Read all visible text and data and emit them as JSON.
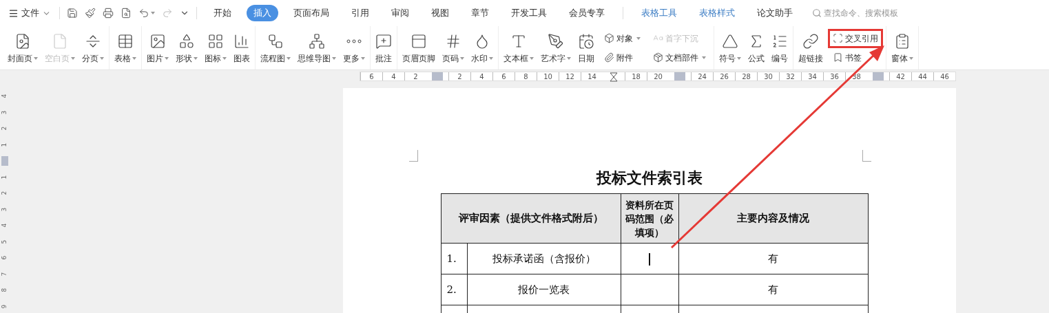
{
  "menu_bar": {
    "file_menu": "文件",
    "tabs": [
      {
        "label": "开始",
        "selected": false,
        "contextual": false
      },
      {
        "label": "插入",
        "selected": true,
        "contextual": false
      },
      {
        "label": "页面布局",
        "selected": false,
        "contextual": false
      },
      {
        "label": "引用",
        "selected": false,
        "contextual": false
      },
      {
        "label": "审阅",
        "selected": false,
        "contextual": false
      },
      {
        "label": "视图",
        "selected": false,
        "contextual": false
      },
      {
        "label": "章节",
        "selected": false,
        "contextual": false
      },
      {
        "label": "开发工具",
        "selected": false,
        "contextual": false
      },
      {
        "label": "会员专享",
        "selected": false,
        "contextual": false
      },
      {
        "label": "表格工具",
        "selected": false,
        "contextual": true
      },
      {
        "label": "表格样式",
        "selected": false,
        "contextual": true
      },
      {
        "label": "论文助手",
        "selected": false,
        "contextual": false
      }
    ],
    "search": {
      "placeholder": "查找命令、搜索模板"
    }
  },
  "ribbon": {
    "groups": [
      {
        "items": [
          {
            "kind": "large",
            "label": "封面页",
            "dropdown": true,
            "disabled": false
          },
          {
            "kind": "large",
            "label": "空白页",
            "dropdown": true,
            "disabled": true
          },
          {
            "kind": "large",
            "label": "分页",
            "dropdown": true,
            "disabled": false
          }
        ]
      },
      {
        "items": [
          {
            "kind": "large",
            "label": "表格",
            "dropdown": true,
            "disabled": false
          }
        ]
      },
      {
        "items": [
          {
            "kind": "large",
            "label": "图片",
            "dropdown": true,
            "disabled": false
          },
          {
            "kind": "large",
            "label": "形状",
            "dropdown": true,
            "disabled": false
          },
          {
            "kind": "large",
            "label": "图标",
            "dropdown": true,
            "disabled": false
          },
          {
            "kind": "large",
            "label": "图表",
            "dropdown": false,
            "disabled": false
          }
        ]
      },
      {
        "items": [
          {
            "kind": "large",
            "label": "流程图",
            "dropdown": true,
            "disabled": false
          },
          {
            "kind": "large",
            "label": "思维导图",
            "dropdown": true,
            "disabled": false
          },
          {
            "kind": "large",
            "label": "更多",
            "dropdown": true,
            "disabled": false
          }
        ]
      },
      {
        "items": [
          {
            "kind": "large",
            "label": "批注",
            "dropdown": false,
            "disabled": false
          }
        ]
      },
      {
        "items": [
          {
            "kind": "large",
            "label": "页眉页脚",
            "dropdown": false,
            "disabled": false
          },
          {
            "kind": "large",
            "label": "页码",
            "dropdown": true,
            "disabled": false
          },
          {
            "kind": "large",
            "label": "水印",
            "dropdown": true,
            "disabled": false
          }
        ]
      },
      {
        "items": [
          {
            "kind": "large",
            "label": "文本框",
            "dropdown": true,
            "disabled": false
          },
          {
            "kind": "large",
            "label": "艺术字",
            "dropdown": true,
            "disabled": false
          },
          {
            "kind": "large",
            "label": "日期",
            "dropdown": false,
            "disabled": false
          },
          {
            "kind": "stack",
            "rows": [
              {
                "label": "对象",
                "dropdown": true,
                "disabled": false,
                "highlighted": false
              },
              {
                "label": "附件",
                "dropdown": false,
                "disabled": false,
                "highlighted": false
              }
            ]
          },
          {
            "kind": "stack",
            "rows": [
              {
                "label": "首字下沉",
                "dropdown": false,
                "disabled": true,
                "highlighted": false
              },
              {
                "label": "文档部件",
                "dropdown": true,
                "disabled": false,
                "highlighted": false
              }
            ]
          }
        ]
      },
      {
        "items": [
          {
            "kind": "large",
            "label": "符号",
            "dropdown": true,
            "disabled": false
          },
          {
            "kind": "large",
            "label": "公式",
            "dropdown": false,
            "disabled": false
          },
          {
            "kind": "large",
            "label": "编号",
            "dropdown": false,
            "disabled": false
          }
        ]
      },
      {
        "items": [
          {
            "kind": "large",
            "label": "超链接",
            "dropdown": false,
            "disabled": false
          },
          {
            "kind": "stack",
            "rows": [
              {
                "label": "交叉引用",
                "dropdown": false,
                "disabled": false,
                "highlighted": true
              },
              {
                "label": "书签",
                "dropdown": false,
                "disabled": false,
                "highlighted": false
              }
            ]
          }
        ]
      },
      {
        "items": [
          {
            "kind": "large",
            "label": "窗体",
            "dropdown": true,
            "disabled": false
          }
        ]
      }
    ]
  },
  "ruler": {
    "slots": [
      {
        "kind": "num",
        "label": "6"
      },
      {
        "kind": "num",
        "label": "4"
      },
      {
        "kind": "num",
        "label": "2"
      },
      {
        "kind": "margin"
      },
      {
        "kind": "num",
        "label": "2"
      },
      {
        "kind": "num",
        "label": "4"
      },
      {
        "kind": "num",
        "label": "6"
      },
      {
        "kind": "num",
        "label": "8"
      },
      {
        "kind": "num",
        "label": "10"
      },
      {
        "kind": "num",
        "label": "12"
      },
      {
        "kind": "num",
        "label": "14"
      },
      {
        "kind": "indent"
      },
      {
        "kind": "num",
        "label": "18"
      },
      {
        "kind": "num",
        "label": "20"
      },
      {
        "kind": "margin"
      },
      {
        "kind": "num",
        "label": "24"
      },
      {
        "kind": "num",
        "label": "26"
      },
      {
        "kind": "num",
        "label": "28"
      },
      {
        "kind": "num",
        "label": "30"
      },
      {
        "kind": "num",
        "label": "32"
      },
      {
        "kind": "num",
        "label": "34"
      },
      {
        "kind": "num",
        "label": "36"
      },
      {
        "kind": "num",
        "label": "38"
      },
      {
        "kind": "margin"
      },
      {
        "kind": "num",
        "label": "42"
      },
      {
        "kind": "num",
        "label": "44"
      },
      {
        "kind": "num",
        "label": "46"
      }
    ]
  },
  "vertical_ruler": {
    "slots": [
      {
        "kind": "num",
        "label": "4"
      },
      {
        "kind": "num",
        "label": "3"
      },
      {
        "kind": "num",
        "label": "2"
      },
      {
        "kind": "num",
        "label": "1"
      },
      {
        "kind": "margin"
      },
      {
        "kind": "num",
        "label": "1"
      },
      {
        "kind": "num",
        "label": "2"
      },
      {
        "kind": "num",
        "label": "3"
      },
      {
        "kind": "num",
        "label": "4"
      },
      {
        "kind": "num",
        "label": "5"
      },
      {
        "kind": "num",
        "label": "6"
      },
      {
        "kind": "num",
        "label": "7"
      },
      {
        "kind": "num",
        "label": "8"
      },
      {
        "kind": "num",
        "label": "9"
      }
    ]
  },
  "document": {
    "title": "投标文件索引表",
    "table": {
      "columns": [
        "评审因素（提供文件格式附后）",
        "资料所在页码范围（必填项）",
        "主要内容及情况"
      ],
      "rows": [
        {
          "number": "1.",
          "item": "投标承诺函（含报价）",
          "pages": "",
          "caret": true,
          "content": "有"
        },
        {
          "number": "2.",
          "item": "报价一览表",
          "pages": "",
          "caret": false,
          "content": "有"
        }
      ]
    }
  },
  "annotation_arrow": true
}
